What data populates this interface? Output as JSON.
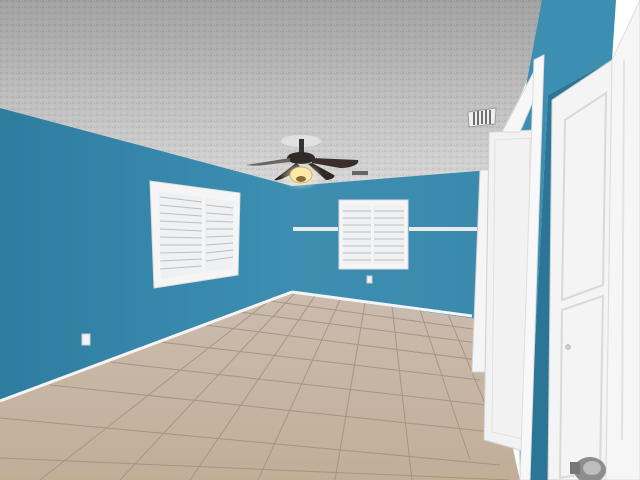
{
  "photo": {
    "kind": "interior-room-photo",
    "colors": {
      "wall": "#3f8fb0",
      "wall_shadow": "#2f789a",
      "ceiling": "#dcdcdc",
      "floor_tile": "#c8b7a6",
      "grout": "#a89684",
      "trim": "#ffffff",
      "door": "#f2f2f2"
    },
    "icons": [
      "ceiling-fan-icon",
      "air-vent-icon",
      "window-shutter-icon",
      "door-icon",
      "door-knob-icon",
      "outlet-icon"
    ]
  }
}
